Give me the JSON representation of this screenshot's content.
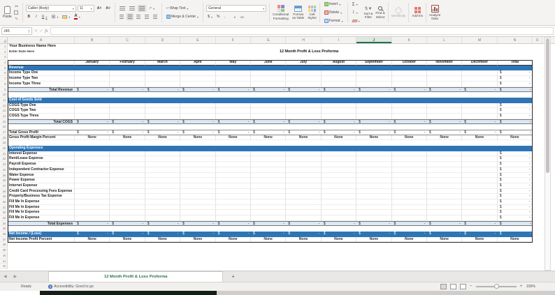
{
  "ribbon": {
    "paste": "Paste",
    "font_name": "Calibri (Body)",
    "font_size": "11",
    "bold": "B",
    "italic": "I",
    "underline": "U",
    "wrap_text": "Wrap Text",
    "merge_center": "Merge & Center",
    "number_format": "General",
    "currency": "$",
    "percent": "%",
    "comma": ",",
    "inc_decimal": ".0",
    "dec_decimal": ".00",
    "conditional_formatting": "Conditional\nFormatting",
    "format_as_table": "Format\nas Table",
    "cell_styles": "Cell\nStyles",
    "insert": "Insert",
    "delete": "Delete",
    "format": "Format",
    "autosum": "Σ",
    "sort_filter": "Sort &\nFilter",
    "find_select": "Find &\nSelect",
    "sensitivity": "Sensitivity",
    "add_ins": "Add-ins",
    "analyze_data": "Analyze\nData"
  },
  "formula_bar": {
    "name_box": "J45",
    "fx": "fx"
  },
  "grid": {
    "column_letters": [
      "A",
      "B",
      "C",
      "D",
      "E",
      "F",
      "G",
      "H",
      "I",
      "J",
      "K",
      "L",
      "M",
      "N",
      "O"
    ],
    "selected_column": "J",
    "center_title": "12 Month Profit & Loss Proforma",
    "months": [
      "January",
      "February",
      "March",
      "April",
      "May",
      "June",
      "July",
      "August",
      "September",
      "October",
      "November",
      "December",
      "Total"
    ],
    "money_symbol": "$",
    "money_value": "-",
    "percent_value": "None",
    "rows": [
      {
        "n": 1,
        "t": "title",
        "label": "Your Business Name Here"
      },
      {
        "n": 2,
        "t": "subtitle",
        "label": "Enter Date Here"
      },
      {
        "n": 3,
        "t": "outside"
      },
      {
        "n": 4,
        "t": "months"
      },
      {
        "n": 5,
        "t": "banner",
        "label": "Revenue"
      },
      {
        "n": 6,
        "t": "item",
        "label": "Income Type One"
      },
      {
        "n": 7,
        "t": "item",
        "label": "Income Type Two"
      },
      {
        "n": 8,
        "t": "item",
        "label": "Income Type Three"
      },
      {
        "n": 9,
        "t": "total",
        "label": "Total Revenue"
      },
      {
        "n": 10,
        "t": "spacer"
      },
      {
        "n": 11,
        "t": "banner",
        "label": "Cost of Goods Sold"
      },
      {
        "n": 12,
        "t": "item",
        "label": "COGS Type One"
      },
      {
        "n": 13,
        "t": "item",
        "label": "COGS Type Two"
      },
      {
        "n": 14,
        "t": "item",
        "label": "COGS Type Three"
      },
      {
        "n": 15,
        "t": "total",
        "label": "Total COGS"
      },
      {
        "n": 16,
        "t": "spacer"
      },
      {
        "n": 17,
        "t": "gross",
        "label": "Total Gross Profit"
      },
      {
        "n": 18,
        "t": "percent",
        "label": "Gross Profit Margin Percent"
      },
      {
        "n": 19,
        "t": "spacer"
      },
      {
        "n": 20,
        "t": "banner",
        "label": "Operating Expenses"
      },
      {
        "n": 21,
        "t": "item",
        "label": "Interest Expense"
      },
      {
        "n": 22,
        "t": "item",
        "label": "Rent/Lease Expense"
      },
      {
        "n": 23,
        "t": "item",
        "label": "Payroll Expense"
      },
      {
        "n": 24,
        "t": "item",
        "label": "Independent Contractor Expense"
      },
      {
        "n": 25,
        "t": "item",
        "label": "Water Expense"
      },
      {
        "n": 26,
        "t": "item",
        "label": "Power Expense"
      },
      {
        "n": 27,
        "t": "item",
        "label": "Internet Expense"
      },
      {
        "n": 28,
        "t": "item",
        "label": "Credit Card Processing Fees Expense"
      },
      {
        "n": 29,
        "t": "item",
        "label": "Property/Business Tax Expense"
      },
      {
        "n": 30,
        "t": "item",
        "label": "Fill Me In Expense"
      },
      {
        "n": 31,
        "t": "item",
        "label": "Fill Me In Expense"
      },
      {
        "n": 32,
        "t": "item",
        "label": "Fill Me In Expense"
      },
      {
        "n": 33,
        "t": "item",
        "label": "Fill Me In Expense"
      },
      {
        "n": 34,
        "t": "total",
        "label": "Total Expenses"
      },
      {
        "n": 35,
        "t": "spacer"
      },
      {
        "n": 36,
        "t": "banner_values",
        "label": "Net Income / (Loss)"
      },
      {
        "n": 37,
        "t": "percent",
        "label": "Net Income Profit Percent"
      },
      {
        "n": 38,
        "t": "outside"
      },
      {
        "n": 39,
        "t": "outside"
      },
      {
        "n": 40,
        "t": "outside"
      },
      {
        "n": 41,
        "t": "outside"
      },
      {
        "n": 42,
        "t": "outside"
      }
    ]
  },
  "sheet_tabs": {
    "active": "12 Month Profit & Loss Proforma",
    "add_label": "+"
  },
  "status_bar": {
    "ready": "Ready",
    "accessibility": "Accessibility: Good to go",
    "zoom_level": "100%"
  },
  "colors": {
    "banner_blue": "#2e75b6",
    "total_row_blue": "#dbe8f5",
    "excel_green": "#217346",
    "addins_red": "#e07b6f",
    "font_color_red": "#c00000"
  }
}
